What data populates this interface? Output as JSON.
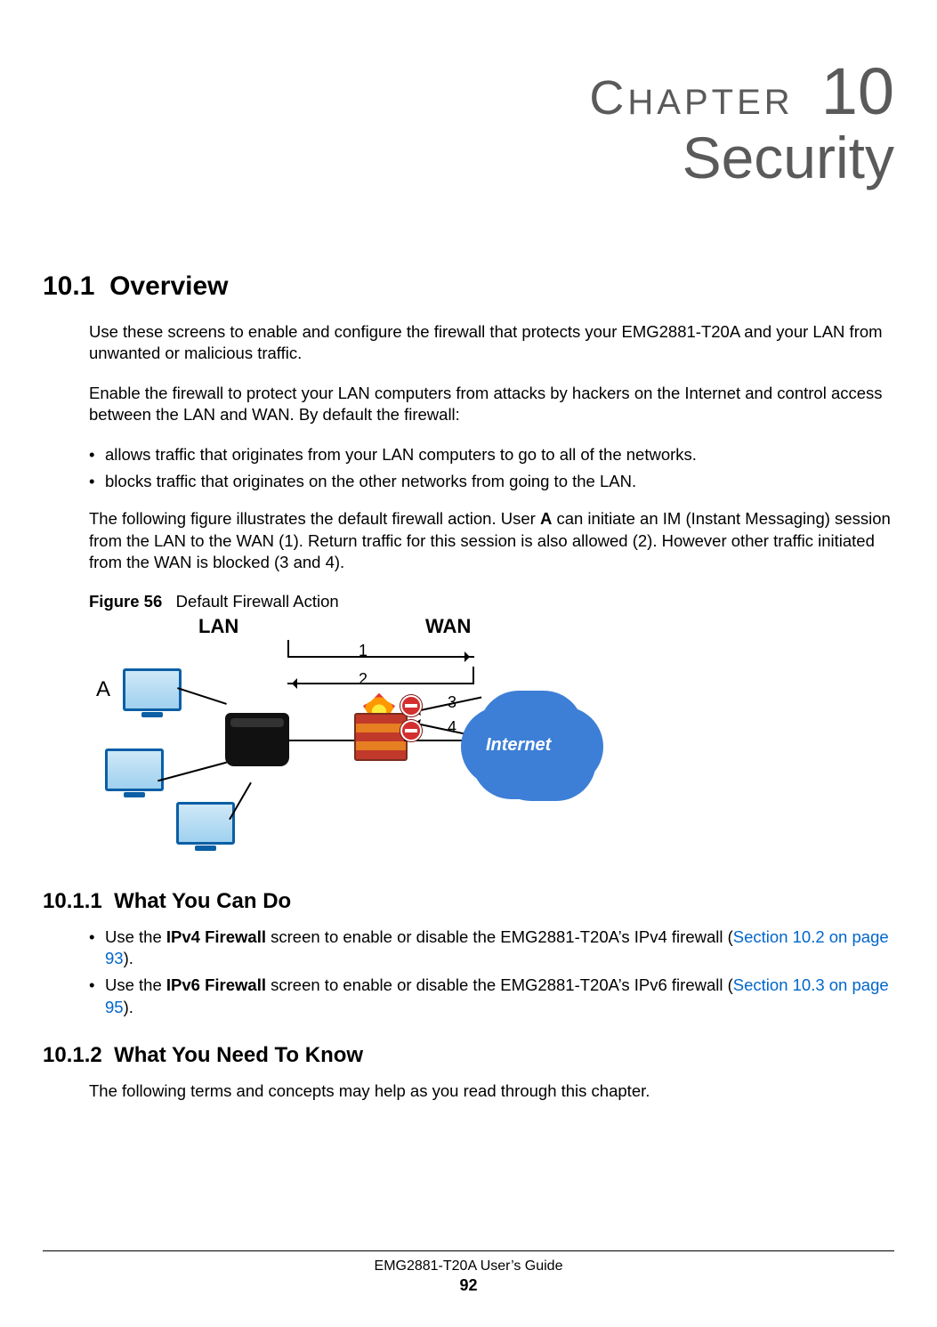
{
  "chapter": {
    "word_initial": "C",
    "word_rest": "HAPTER",
    "number": "10",
    "title": "Security"
  },
  "sec_overview": {
    "number": "10.1",
    "title": "Overview",
    "p1": "Use these screens to enable and configure the firewall that protects your EMG2881-T20A and your LAN from unwanted or malicious traffic.",
    "p2": "Enable the firewall to protect your LAN computers from attacks by hackers on the Internet and control access between the LAN and WAN. By default the firewall:",
    "bullets": [
      "allows traffic that originates from your LAN computers to go to all of the networks.",
      "blocks traffic that originates on the other networks from going to the LAN."
    ],
    "p3_a": "The following figure illustrates the default firewall action. User ",
    "p3_bold": "A",
    "p3_b": " can initiate an IM (Instant Messaging) session from the LAN to the WAN (1). Return traffic for this session is also allowed (2). However other traffic initiated from the WAN is blocked (3 and 4)."
  },
  "figure": {
    "label": "Figure 56",
    "caption": "Default Firewall Action",
    "labels": {
      "lan": "LAN",
      "wan": "WAN",
      "a": "A",
      "n1": "1",
      "n2": "2",
      "n3": "3",
      "n4": "4",
      "internet": "Internet"
    }
  },
  "sec_wycd": {
    "number": "10.1.1",
    "title": "What You Can Do",
    "items": [
      {
        "pre": "Use the ",
        "bold": "IPv4 Firewall",
        "mid": " screen to enable or disable the EMG2881-T20A’s IPv4 firewall (",
        "link": "Section 10.2 on page 93",
        "post": ")."
      },
      {
        "pre": "Use the ",
        "bold": "IPv6 Firewall ",
        "mid": " screen to enable or disable the EMG2881-T20A’s IPv6 firewall (",
        "link": "Section 10.3 on page 95",
        "post": ")."
      }
    ]
  },
  "sec_wyntk": {
    "number": "10.1.2",
    "title": "What You Need To Know",
    "p1": "The following terms and concepts may help as you read through this chapter."
  },
  "footer": {
    "guide": "EMG2881-T20A User’s Guide",
    "page": "92"
  }
}
